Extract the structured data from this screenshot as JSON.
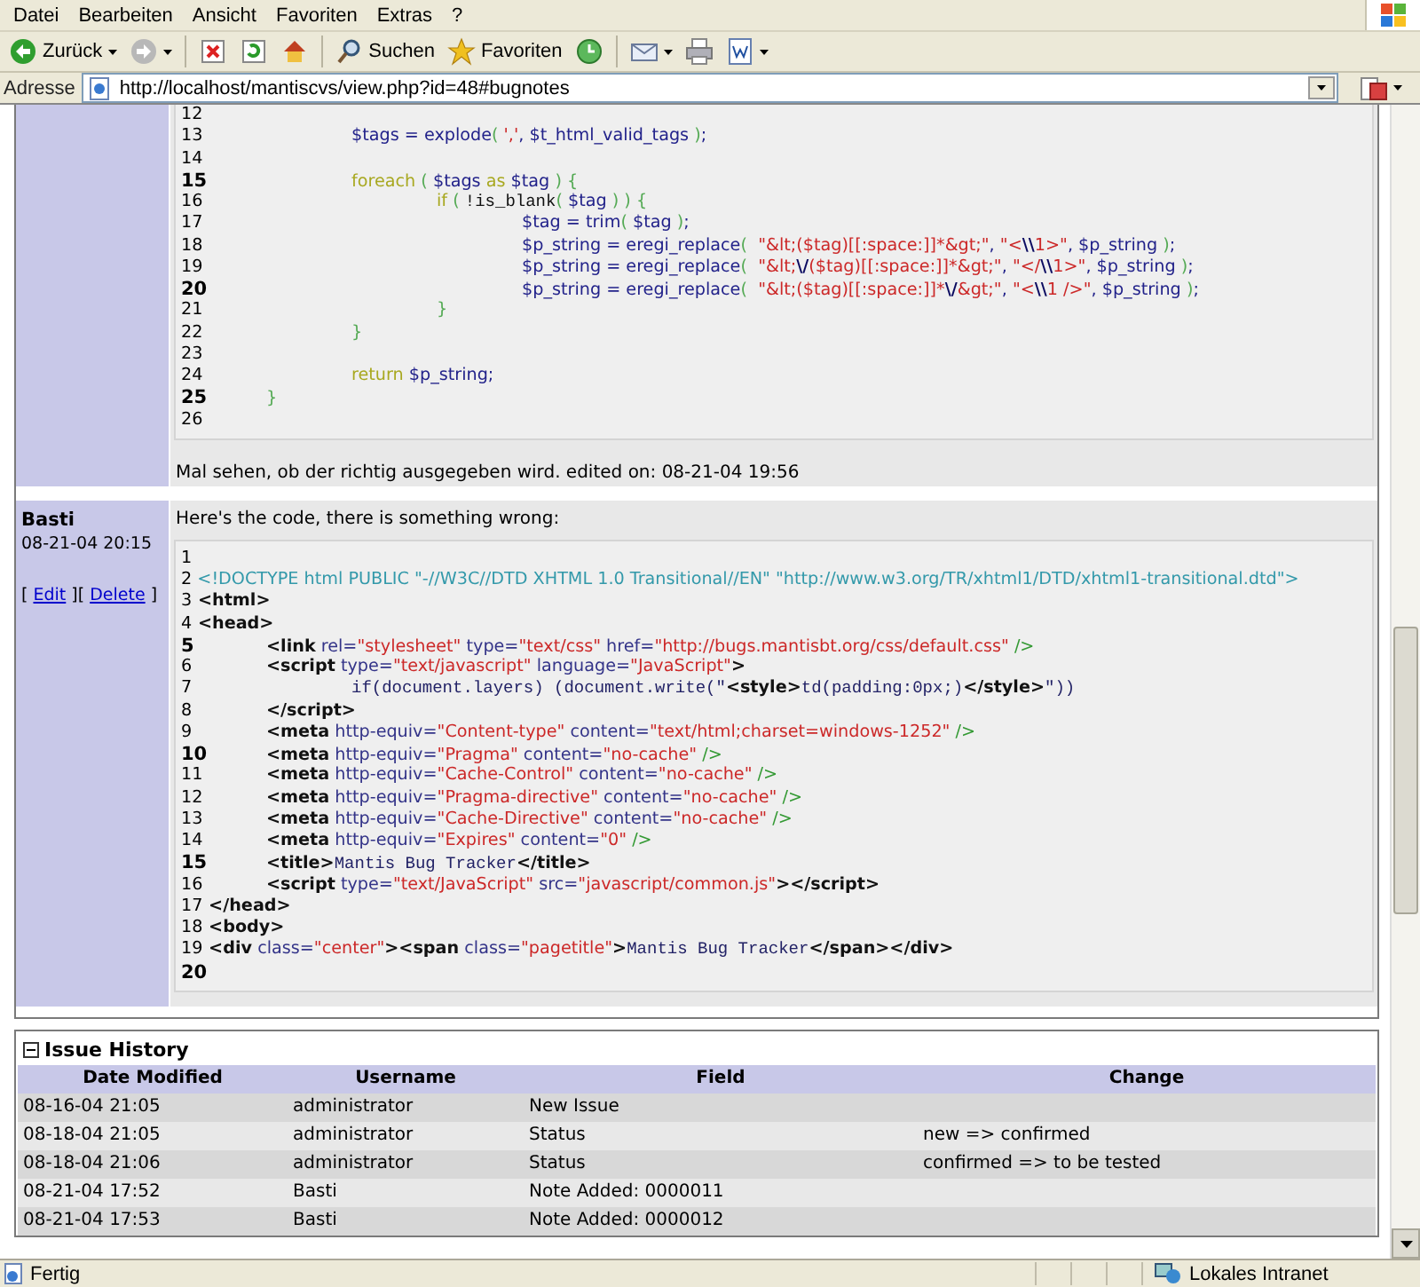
{
  "menu": [
    "Datei",
    "Bearbeiten",
    "Ansicht",
    "Favoriten",
    "Extras",
    "?"
  ],
  "toolbar": [
    {
      "kind": "back",
      "label": "Zurück",
      "menu": true
    },
    {
      "kind": "forward",
      "menu": true
    },
    {
      "kind": "separator"
    },
    {
      "kind": "stop",
      "menu": false
    },
    {
      "kind": "refresh",
      "menu": false
    },
    {
      "kind": "home",
      "menu": false
    },
    {
      "kind": "separator"
    },
    {
      "kind": "search",
      "label": "Suchen",
      "menu": false
    },
    {
      "kind": "favorites",
      "label": "Favoriten",
      "menu": false
    },
    {
      "kind": "history",
      "menu": false
    },
    {
      "kind": "separator"
    },
    {
      "kind": "mail",
      "menu": true
    },
    {
      "kind": "print",
      "menu": false
    },
    {
      "kind": "edit",
      "menu": true
    }
  ],
  "address": {
    "label": "Adresse",
    "url": "http://localhost/mantiscvs/view.php?id=48#bugnotes"
  },
  "notes": [
    {
      "code": [
        {
          "n": "12",
          "bold": false
        },
        {
          "n": "13",
          "bold": false,
          "code": [
            {
              "text": "\t\t$tags = explode",
              "kind": "v"
            },
            {
              "text": "( ",
              "kind": "p"
            },
            {
              "text": "','",
              "kind": "s"
            },
            {
              "text": ", $t_html_valid_tags ",
              "kind": "v"
            },
            {
              "text": ")",
              "kind": "p"
            },
            {
              "text": ";",
              "kind": "v"
            }
          ]
        },
        {
          "n": "14",
          "bold": false
        },
        {
          "n": "15",
          "bold": true,
          "code": [
            {
              "text": "\t\tforeach",
              "kind": "k"
            },
            {
              "text": " ( ",
              "kind": "p"
            },
            {
              "text": "$tags ",
              "kind": "v"
            },
            {
              "text": "as",
              "kind": "k"
            },
            {
              "text": " $tag ",
              "kind": "v"
            },
            {
              "text": ") {",
              "kind": "p"
            }
          ]
        },
        {
          "n": "16",
          "bold": false,
          "code": [
            {
              "text": "\t\t\tif",
              "kind": "k"
            },
            {
              "text": " ( ",
              "kind": "p"
            },
            {
              "text": "!is_blank",
              "kind": "m"
            },
            {
              "text": "( ",
              "kind": "p"
            },
            {
              "text": "$tag",
              "kind": "v"
            },
            {
              "text": " ) ) {",
              "kind": "p"
            }
          ]
        },
        {
          "n": "17",
          "bold": false,
          "code": [
            {
              "text": "\t\t\t\t$tag = trim",
              "kind": "v"
            },
            {
              "text": "( ",
              "kind": "p"
            },
            {
              "text": "$tag",
              "kind": "v"
            },
            {
              "text": " )",
              "kind": "p"
            },
            {
              "text": ";",
              "kind": "v"
            }
          ]
        },
        {
          "n": "18",
          "bold": false,
          "code": [
            {
              "text": "\t\t\t\t$p_string = eregi_replace",
              "kind": "v"
            },
            {
              "text": "(  ",
              "kind": "p"
            },
            {
              "text": "\"&lt;($tag)[[:space:]]*&gt;\"",
              "kind": "s"
            },
            {
              "text": ", ",
              "kind": "v"
            },
            {
              "text": "\"<",
              "kind": "s"
            },
            {
              "text": "\\\\",
              "kind": "e"
            },
            {
              "text": "1>\"",
              "kind": "s"
            },
            {
              "text": ", $p_string ",
              "kind": "v"
            },
            {
              "text": ")",
              "kind": "p"
            },
            {
              "text": ";",
              "kind": "v"
            }
          ]
        },
        {
          "n": "19",
          "bold": false,
          "code": [
            {
              "text": "\t\t\t\t$p_string = eregi_replace",
              "kind": "v"
            },
            {
              "text": "(  ",
              "kind": "p"
            },
            {
              "text": "\"&lt;",
              "kind": "s"
            },
            {
              "text": "\\/",
              "kind": "e"
            },
            {
              "text": "($tag)[[:space:]]*&gt;\"",
              "kind": "s"
            },
            {
              "text": ", ",
              "kind": "v"
            },
            {
              "text": "\"</",
              "kind": "s"
            },
            {
              "text": "\\\\",
              "kind": "e"
            },
            {
              "text": "1>\"",
              "kind": "s"
            },
            {
              "text": ", $p_string ",
              "kind": "v"
            },
            {
              "text": ")",
              "kind": "p"
            },
            {
              "text": ";",
              "kind": "v"
            }
          ]
        },
        {
          "n": "20",
          "bold": true,
          "code": [
            {
              "text": "\t\t\t\t$p_string = eregi_replace",
              "kind": "v"
            },
            {
              "text": "(  ",
              "kind": "p"
            },
            {
              "text": "\"&lt;($tag)[[:space:]]*",
              "kind": "s"
            },
            {
              "text": "\\/",
              "kind": "e"
            },
            {
              "text": "&gt;\"",
              "kind": "s"
            },
            {
              "text": ", ",
              "kind": "v"
            },
            {
              "text": "\"<",
              "kind": "s"
            },
            {
              "text": "\\\\",
              "kind": "e"
            },
            {
              "text": "1 />\"",
              "kind": "s"
            },
            {
              "text": ", $p_string ",
              "kind": "v"
            },
            {
              "text": ")",
              "kind": "p"
            },
            {
              "text": ";",
              "kind": "v"
            }
          ]
        },
        {
          "n": "21",
          "bold": false,
          "code": [
            {
              "text": "\t\t\t}",
              "kind": "p"
            }
          ]
        },
        {
          "n": "22",
          "bold": false,
          "code": [
            {
              "text": "\t\t}",
              "kind": "p"
            }
          ]
        },
        {
          "n": "23",
          "bold": false
        },
        {
          "n": "24",
          "bold": false,
          "code": [
            {
              "text": "\t\treturn",
              "kind": "k"
            },
            {
              "text": " $p_string;",
              "kind": "v"
            }
          ]
        },
        {
          "n": "25",
          "bold": true,
          "code": [
            {
              "text": "\t}",
              "kind": "p"
            }
          ]
        },
        {
          "n": "26",
          "bold": false
        }
      ],
      "text": "Mal sehen, ob der richtig ausgegeben wird. edited on: 08-21-04 19:56"
    },
    {
      "author": "Basti",
      "date": "08-21-04 20:15",
      "actions": [
        {
          "text": "[ ",
          "kind": "text"
        },
        {
          "text": "Edit",
          "kind": "link"
        },
        {
          "text": " ][ ",
          "kind": "text"
        },
        {
          "text": "Delete",
          "kind": "link"
        },
        {
          "text": " ]",
          "kind": "text"
        }
      ],
      "intro": "Here's the code, there is something wrong:",
      "code": [
        {
          "n": "1",
          "bold": false
        },
        {
          "n": "2",
          "bold": false,
          "code": [
            {
              "text": " <!DOCTYPE html PUBLIC \"-//W3C//DTD XHTML 1.0 Transitional//EN\" \"http://www.w3.org/TR/xhtml1/DTD/xhtml1-transitional.dtd\">",
              "kind": "d"
            }
          ]
        },
        {
          "n": "3",
          "bold": false,
          "code": [
            {
              "text": " <html>",
              "kind": "t"
            }
          ]
        },
        {
          "n": "4",
          "bold": false,
          "code": [
            {
              "text": " <head>",
              "kind": "t"
            }
          ]
        },
        {
          "n": "5",
          "bold": true,
          "code": [
            {
              "text": "\t<link",
              "kind": "t"
            },
            {
              "text": " rel=",
              "kind": "a"
            },
            {
              "text": "\"stylesheet\"",
              "kind": "s"
            },
            {
              "text": " type=",
              "kind": "a"
            },
            {
              "text": "\"text/css\"",
              "kind": "s"
            },
            {
              "text": " href=",
              "kind": "a"
            },
            {
              "text": "\"http://bugs.mantisbt.org/css/default.css\"",
              "kind": "s"
            },
            {
              "text": " />",
              "kind": "g"
            }
          ]
        },
        {
          "n": "6",
          "bold": false,
          "code": [
            {
              "text": "\t<script",
              "kind": "t"
            },
            {
              "text": " type=",
              "kind": "a"
            },
            {
              "text": "\"text/javascript\"",
              "kind": "s"
            },
            {
              "text": " language=",
              "kind": "a"
            },
            {
              "text": "\"JavaScript\"",
              "kind": "s"
            },
            {
              "text": ">",
              "kind": "t"
            }
          ]
        },
        {
          "n": "7",
          "bold": false,
          "code": [
            {
              "text": "\t\tif(document.layers) (document.write(\"",
              "kind": "mn"
            },
            {
              "text": "<style>",
              "kind": "t"
            },
            {
              "text": "td(padding:0px;)",
              "kind": "mn"
            },
            {
              "text": "</style>",
              "kind": "t"
            },
            {
              "text": "\"))",
              "kind": "mn"
            }
          ]
        },
        {
          "n": "8",
          "bold": false,
          "code": [
            {
              "text": "\t</script>",
              "kind": "t"
            }
          ]
        },
        {
          "n": "9",
          "bold": false,
          "code": [
            {
              "text": "\t<meta",
              "kind": "t"
            },
            {
              "text": " http-equiv=",
              "kind": "a"
            },
            {
              "text": "\"Content-type\"",
              "kind": "s"
            },
            {
              "text": " content=",
              "kind": "a"
            },
            {
              "text": "\"text/html;charset=windows-1252\"",
              "kind": "s"
            },
            {
              "text": " />",
              "kind": "g"
            }
          ]
        },
        {
          "n": "10",
          "bold": true,
          "code": [
            {
              "text": "\t<meta",
              "kind": "t"
            },
            {
              "text": " http-equiv=",
              "kind": "a"
            },
            {
              "text": "\"Pragma\"",
              "kind": "s"
            },
            {
              "text": " content=",
              "kind": "a"
            },
            {
              "text": "\"no-cache\"",
              "kind": "s"
            },
            {
              "text": " />",
              "kind": "g"
            }
          ]
        },
        {
          "n": "11",
          "bold": false,
          "code": [
            {
              "text": "\t<meta",
              "kind": "t"
            },
            {
              "text": " http-equiv=",
              "kind": "a"
            },
            {
              "text": "\"Cache-Control\"",
              "kind": "s"
            },
            {
              "text": " content=",
              "kind": "a"
            },
            {
              "text": "\"no-cache\"",
              "kind": "s"
            },
            {
              "text": " />",
              "kind": "g"
            }
          ]
        },
        {
          "n": "12",
          "bold": false,
          "code": [
            {
              "text": "\t<meta",
              "kind": "t"
            },
            {
              "text": " http-equiv=",
              "kind": "a"
            },
            {
              "text": "\"Pragma-directive\"",
              "kind": "s"
            },
            {
              "text": " content=",
              "kind": "a"
            },
            {
              "text": "\"no-cache\"",
              "kind": "s"
            },
            {
              "text": " />",
              "kind": "g"
            }
          ]
        },
        {
          "n": "13",
          "bold": false,
          "code": [
            {
              "text": "\t<meta",
              "kind": "t"
            },
            {
              "text": " http-equiv=",
              "kind": "a"
            },
            {
              "text": "\"Cache-Directive\"",
              "kind": "s"
            },
            {
              "text": " content=",
              "kind": "a"
            },
            {
              "text": "\"no-cache\"",
              "kind": "s"
            },
            {
              "text": " />",
              "kind": "g"
            }
          ]
        },
        {
          "n": "14",
          "bold": false,
          "code": [
            {
              "text": "\t<meta",
              "kind": "t"
            },
            {
              "text": " http-equiv=",
              "kind": "a"
            },
            {
              "text": "\"Expires\"",
              "kind": "s"
            },
            {
              "text": " content=",
              "kind": "a"
            },
            {
              "text": "\"0\"",
              "kind": "s"
            },
            {
              "text": " />",
              "kind": "g"
            }
          ]
        },
        {
          "n": "15",
          "bold": true,
          "code": [
            {
              "text": "\t<title>",
              "kind": "t"
            },
            {
              "text": "Mantis Bug Tracker",
              "kind": "mn"
            },
            {
              "text": "</title>",
              "kind": "t"
            }
          ]
        },
        {
          "n": "16",
          "bold": false,
          "code": [
            {
              "text": "\t<script",
              "kind": "t"
            },
            {
              "text": " type=",
              "kind": "a"
            },
            {
              "text": "\"text/JavaScript\"",
              "kind": "s"
            },
            {
              "text": " src=",
              "kind": "a"
            },
            {
              "text": "\"javascript/common.js\"",
              "kind": "s"
            },
            {
              "text": "></script>",
              "kind": "t"
            }
          ]
        },
        {
          "n": "17",
          "bold": false,
          "code": [
            {
              "text": " </head>",
              "kind": "t"
            }
          ]
        },
        {
          "n": "18",
          "bold": false,
          "code": [
            {
              "text": " <body>",
              "kind": "t"
            }
          ]
        },
        {
          "n": "19",
          "bold": false,
          "code": [
            {
              "text": " <div",
              "kind": "t"
            },
            {
              "text": " class=",
              "kind": "a"
            },
            {
              "text": "\"center\"",
              "kind": "s"
            },
            {
              "text": "><span",
              "kind": "t"
            },
            {
              "text": " class=",
              "kind": "a"
            },
            {
              "text": "\"pagetitle\"",
              "kind": "s"
            },
            {
              "text": ">",
              "kind": "t"
            },
            {
              "text": "Mantis Bug Tracker",
              "kind": "mn"
            },
            {
              "text": "</span></div>",
              "kind": "t"
            }
          ]
        },
        {
          "n": "20",
          "bold": true
        }
      ]
    }
  ],
  "history": {
    "title": "Issue History",
    "expanded": true,
    "columns": [
      "Date Modified",
      "Username",
      "Field",
      "Change"
    ],
    "rows": [
      [
        "08-16-04 21:05",
        "administrator",
        "New Issue",
        ""
      ],
      [
        "08-18-04 21:05",
        "administrator",
        "Status",
        "new => confirmed"
      ],
      [
        "08-18-04 21:06",
        "administrator",
        "Status",
        "confirmed => to be tested"
      ],
      [
        "08-21-04 17:52",
        "Basti",
        "Note Added: 0000011",
        ""
      ],
      [
        "08-21-04 17:53",
        "Basti",
        "Note Added: 0000012",
        ""
      ]
    ]
  },
  "status_bar": {
    "text": "Fertig",
    "zone": "Lokales Intranet"
  }
}
